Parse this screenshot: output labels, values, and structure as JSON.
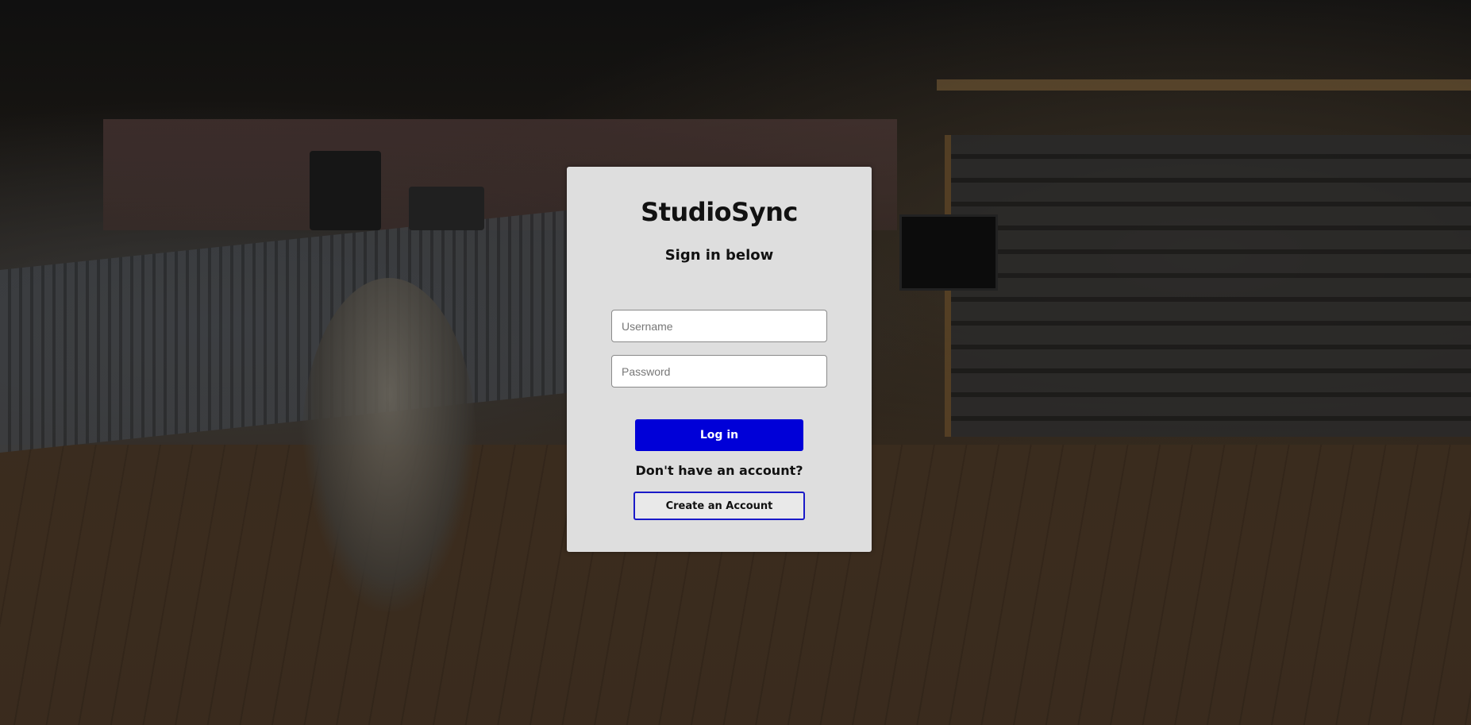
{
  "login": {
    "app_title": "StudioSync",
    "subtitle": "Sign in below",
    "username_placeholder": "Username",
    "username_value": "",
    "password_placeholder": "Password",
    "password_value": "",
    "login_button": "Log in",
    "no_account_text": "Don't have an account?",
    "create_account_button": "Create an Account"
  },
  "colors": {
    "card_background": "#dedede",
    "primary_button": "#0000d8",
    "secondary_button_border": "#1a1ac8",
    "text": "#111111"
  }
}
